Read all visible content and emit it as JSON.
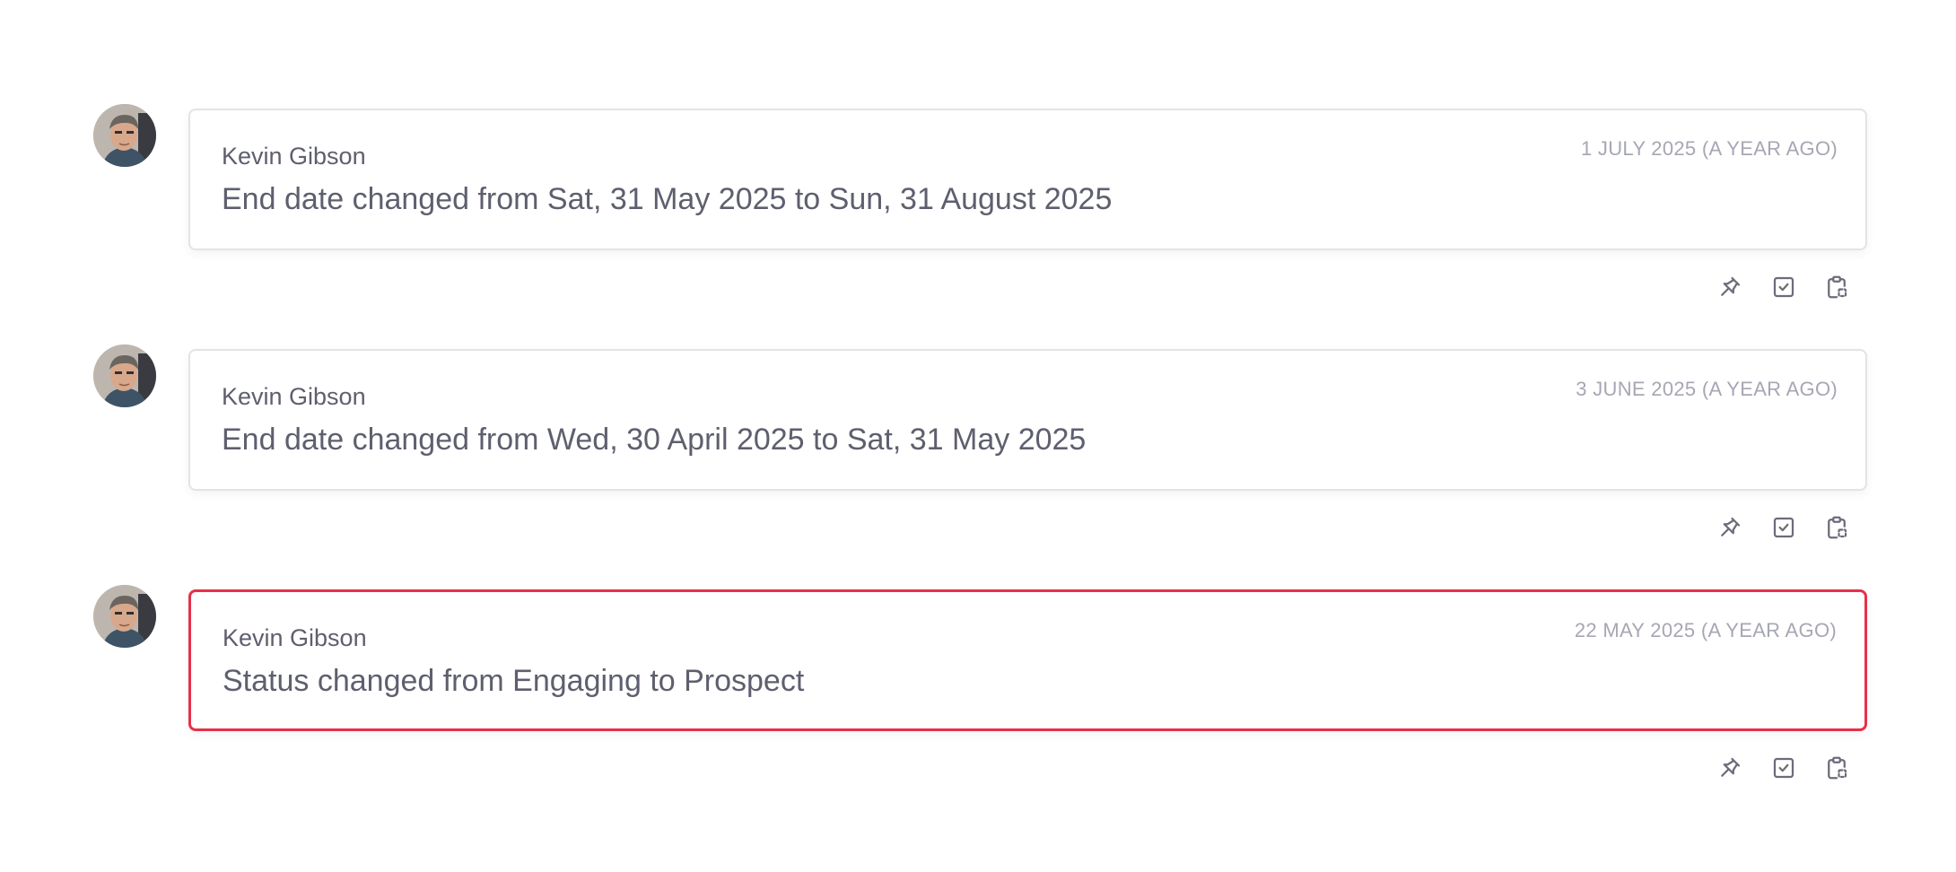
{
  "entries": [
    {
      "author": "Kevin Gibson",
      "timestamp": "1 JULY 2025 (A YEAR AGO)",
      "message": "End date changed from Sat, 31 May 2025 to Sun, 31 August 2025",
      "highlighted": false
    },
    {
      "author": "Kevin Gibson",
      "timestamp": "3 JUNE 2025 (A YEAR AGO)",
      "message": "End date changed from Wed, 30 April 2025 to Sat, 31 May 2025",
      "highlighted": false
    },
    {
      "author": "Kevin Gibson",
      "timestamp": "22 MAY 2025 (A YEAR AGO)",
      "message": "Status changed from Engaging to Prospect",
      "highlighted": true
    }
  ],
  "icons": {
    "pin": "pin-icon",
    "complete": "checkbox-icon",
    "copy": "clipboard-icon"
  },
  "colors": {
    "highlight_border": "#e8304a",
    "card_border": "#e3e3e8",
    "text": "#5e5f6e",
    "timestamp": "#a6a7b3"
  }
}
